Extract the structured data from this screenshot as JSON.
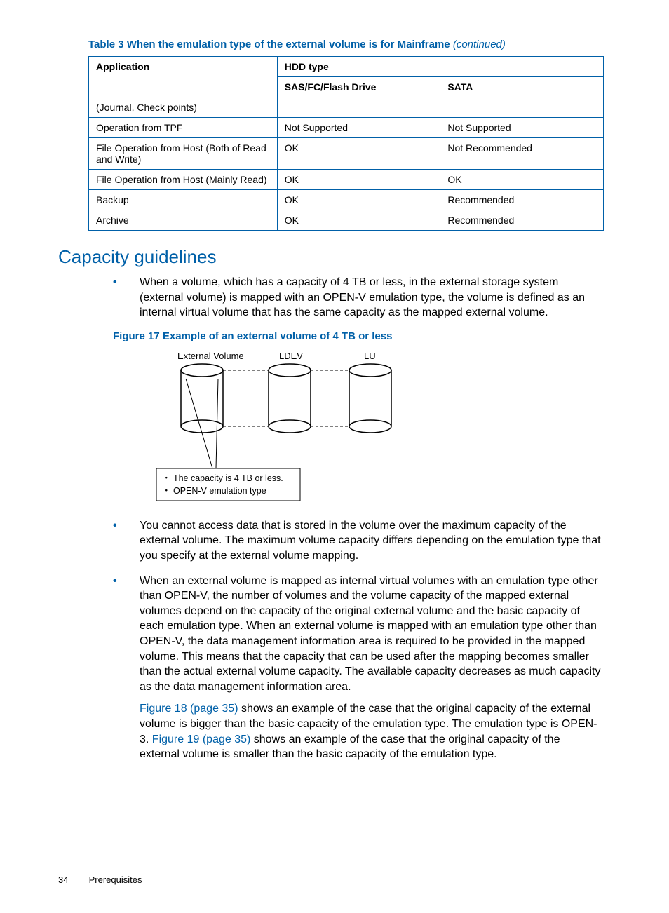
{
  "table": {
    "caption_prefix": "Table 3 When the emulation type of the external volume is for Mainframe",
    "caption_suffix": "(continued)",
    "headers": {
      "application": "Application",
      "hdd": "HDD type",
      "c1": "SAS/FC/Flash Drive",
      "c2": "SATA"
    },
    "rows": [
      {
        "app": "(Journal, Check points)",
        "c1": "",
        "c2": ""
      },
      {
        "app": "Operation from TPF",
        "c1": "Not Supported",
        "c2": "Not Supported"
      },
      {
        "app": "File Operation from Host (Both of Read and Write)",
        "c1": "OK",
        "c2": "Not Recommended"
      },
      {
        "app": "File Operation from Host (Mainly Read)",
        "c1": "OK",
        "c2": "OK"
      },
      {
        "app": "Backup",
        "c1": "OK",
        "c2": "Recommended"
      },
      {
        "app": "Archive",
        "c1": "OK",
        "c2": "Recommended"
      }
    ]
  },
  "section_heading": "Capacity guidelines",
  "bullets": {
    "b1": "When a volume, which has a capacity of 4 TB or less, in the external storage system (external volume) is mapped with an OPEN-V emulation type, the volume is defined as an internal virtual volume that has the same capacity as the mapped external volume.",
    "b2": "You cannot access data that is stored in the volume over the maximum capacity of the external volume. The maximum volume capacity differs depending on the emulation type that you specify at the external volume mapping.",
    "b3": "When an external volume is mapped as internal virtual volumes with an emulation type other than OPEN-V, the number of volumes and the volume capacity of the mapped external volumes depend on the capacity of the original external volume and the basic capacity of each emulation type. When an external volume is mapped with an emulation type other than OPEN-V, the data management information area is required to be provided in the mapped volume. This means that the capacity that can be used after the mapping becomes smaller than the actual external volume capacity. The available capacity decreases as much capacity as the data management information area.",
    "b3_para_link1": "Figure 18 (page 35)",
    "b3_para_after1": " shows an example of the case that the original capacity of the external volume is bigger than the basic capacity of the emulation type. The emulation type is OPEN-3. ",
    "b3_para_link2": "Figure 19 (page 35)",
    "b3_para_after2": " shows an example of the case that the original capacity of the external volume is smaller than the basic capacity of the emulation type."
  },
  "figure": {
    "caption": "Figure 17 Example of an external volume of 4 TB or less",
    "labels": {
      "ext": "External Volume",
      "ldev": "LDEV",
      "lu": "LU",
      "note1": "・ The capacity is 4 TB or less.",
      "note2": "・ OPEN-V emulation type"
    }
  },
  "footer": {
    "page": "34",
    "section": "Prerequisites"
  }
}
